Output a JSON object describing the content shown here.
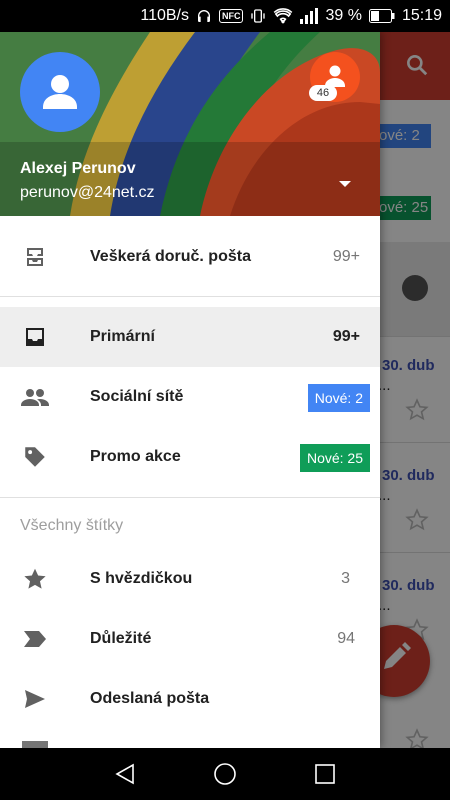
{
  "status_bar": {
    "speed": "110B/s",
    "nfc": "NFC",
    "battery": "39 %",
    "time": "15:19"
  },
  "background": {
    "badges": [
      {
        "text": "ové: 2",
        "color": "#4285f4"
      },
      {
        "text": "ové: 25",
        "color": "#0f9d58"
      }
    ],
    "dates": [
      "30. dub",
      "30. dub",
      "30. dub"
    ],
    "ellipsis": "..."
  },
  "account": {
    "name": "Alexej Perunov",
    "email": "perunov@24net.cz",
    "other_count": "46"
  },
  "menu": {
    "all_inbox": {
      "label": "Veškerá doruč. pošta",
      "count": "99+"
    },
    "primary": {
      "label": "Primární",
      "count": "99+"
    },
    "social": {
      "label": "Sociální sítě",
      "badge": "Nové: 2",
      "badge_color": "#4285f4"
    },
    "promotions": {
      "label": "Promo akce",
      "badge": "Nové: 25",
      "badge_color": "#0f9d58"
    },
    "labels_header": "Všechny štítky",
    "starred": {
      "label": "S hvězdičkou",
      "count": "3"
    },
    "important": {
      "label": "Důležité",
      "count": "94"
    },
    "sent": {
      "label": "Odeslaná pošta"
    }
  }
}
